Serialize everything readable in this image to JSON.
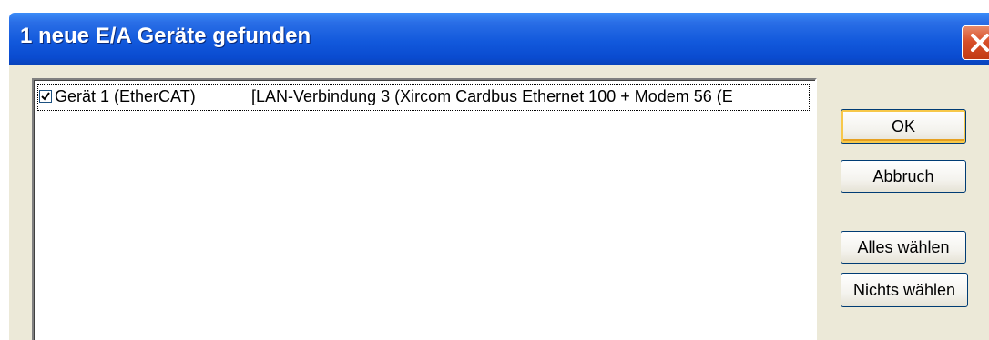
{
  "window": {
    "title": "1 neue E/A Geräte gefunden"
  },
  "device_list": {
    "items": [
      {
        "checked": true,
        "name": "Gerät 1 (EtherCAT)",
        "description": "[LAN-Verbindung 3 (Xircom Cardbus Ethernet 100 + Modem 56 (E"
      }
    ]
  },
  "buttons": {
    "ok": "OK",
    "cancel": "Abbruch",
    "select_all": "Alles wählen",
    "select_none": "Nichts wählen"
  },
  "icons": {
    "close": "close-icon",
    "checkbox": "checkmark-icon"
  },
  "colors": {
    "titlebar": "#0a4bd0",
    "dialog_bg": "#ece9d8",
    "close_button": "#d8502a",
    "default_button_highlight": "#f7c84a"
  }
}
